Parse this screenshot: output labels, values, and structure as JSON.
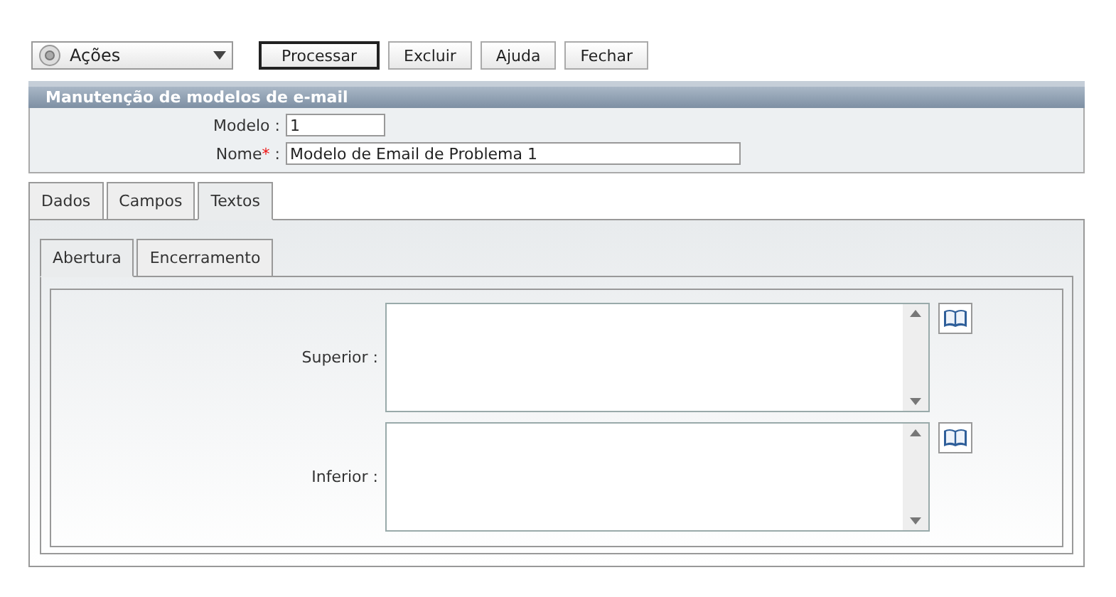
{
  "toolbar": {
    "actions_menu": "Ações",
    "buttons": [
      {
        "label": "Processar",
        "selected": true
      },
      {
        "label": "Excluir",
        "selected": false
      },
      {
        "label": "Ajuda",
        "selected": false
      },
      {
        "label": "Fechar",
        "selected": false
      }
    ]
  },
  "form": {
    "title": "Manutenção de modelos de e-mail",
    "fields": [
      {
        "label": "Modelo :",
        "value": "1",
        "kind": "short"
      },
      {
        "label": "Nome",
        "required_mark": "*",
        "suffix": " :",
        "value": "Modelo de Email de Problema 1",
        "kind": "long"
      }
    ]
  },
  "tabs": [
    {
      "label": "Dados",
      "selected": false
    },
    {
      "label": "Campos",
      "selected": false
    },
    {
      "label": "Textos",
      "selected": true
    }
  ],
  "subtabs": [
    {
      "label": "Abertura",
      "selected": true
    },
    {
      "label": "Encerramento",
      "selected": false
    }
  ],
  "text_areas": [
    {
      "label": "Superior :"
    },
    {
      "label": "Inferior :"
    }
  ]
}
